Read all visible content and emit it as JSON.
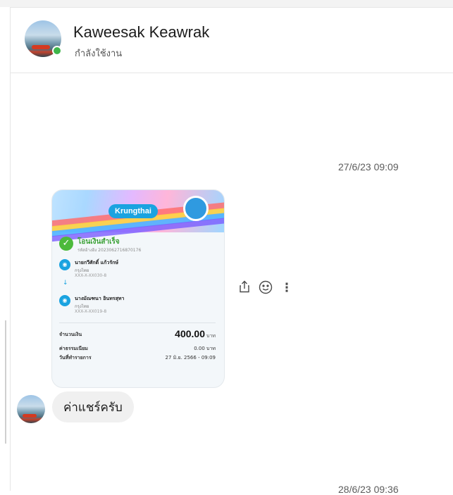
{
  "header": {
    "contact_name": "Kaweesak Keawrak",
    "status": "กำลังใช้งาน",
    "presence_color": "#3fb54a"
  },
  "messages": [
    {
      "timestamp": "27/6/23 09:09",
      "receipt": {
        "bank": "Krungthai",
        "title": "โอนเงินสำเร็จ",
        "reference": "รหัสอ้างอิง 2023062716870176",
        "sender": {
          "name": "นายกวีศักดิ์ แก้วรักษ์",
          "bank": "กรุงไทย",
          "account": "XXX-X-XX030-8"
        },
        "receiver": {
          "name": "นางมัณฑนา อินทรสุทา",
          "bank": "กรุงไทย",
          "account": "XXX-X-XX019-8"
        },
        "amount_label": "จำนวนเงิน",
        "amount_value": "400.00",
        "amount_unit": "บาท",
        "fee_label": "ค่าธรรมเนียม",
        "fee_value": "0.00 บาท",
        "date_label": "วันที่ทำรายการ",
        "date_value": "27 มิ.ย. 2566 - 09:09"
      },
      "text": "ค่าแชร์ครับ"
    },
    {
      "timestamp": "28/6/23 09:36"
    }
  ],
  "actions": {
    "share_icon": "share-icon",
    "emoji_icon": "emoji-icon",
    "more_icon": "more-icon"
  }
}
